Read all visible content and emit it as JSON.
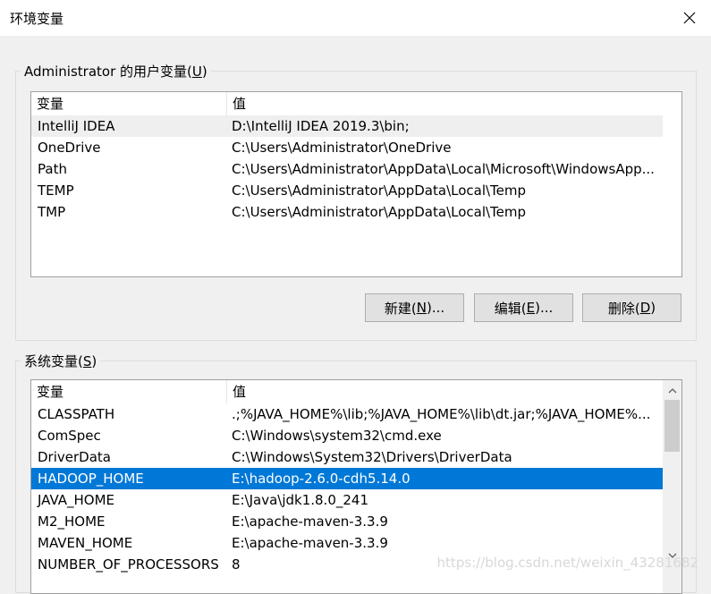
{
  "window": {
    "title": "环境变量"
  },
  "user_group": {
    "label_prefix": "Administrator 的用户变量(",
    "label_key": "U",
    "label_suffix": ")",
    "headers": {
      "name": "变量",
      "value": "值"
    },
    "rows": [
      {
        "name": "IntelliJ IDEA",
        "value": "D:\\IntelliJ IDEA 2019.3\\bin;"
      },
      {
        "name": "OneDrive",
        "value": "C:\\Users\\Administrator\\OneDrive"
      },
      {
        "name": "Path",
        "value": "C:\\Users\\Administrator\\AppData\\Local\\Microsoft\\WindowsApp..."
      },
      {
        "name": "TEMP",
        "value": "C:\\Users\\Administrator\\AppData\\Local\\Temp"
      },
      {
        "name": "TMP",
        "value": "C:\\Users\\Administrator\\AppData\\Local\\Temp"
      }
    ],
    "buttons": {
      "new": {
        "prefix": "新建(",
        "key": "N",
        "suffix": ")..."
      },
      "edit": {
        "prefix": "编辑(",
        "key": "E",
        "suffix": ")..."
      },
      "delete": {
        "prefix": "删除(",
        "key": "D",
        "suffix": ")"
      }
    }
  },
  "system_group": {
    "label_prefix": "系统变量(",
    "label_key": "S",
    "label_suffix": ")",
    "headers": {
      "name": "变量",
      "value": "值"
    },
    "rows": [
      {
        "name": "CLASSPATH",
        "value": ".;%JAVA_HOME%\\lib;%JAVA_HOME%\\lib\\dt.jar;%JAVA_HOME%..."
      },
      {
        "name": "ComSpec",
        "value": "C:\\Windows\\system32\\cmd.exe"
      },
      {
        "name": "DriverData",
        "value": "C:\\Windows\\System32\\Drivers\\DriverData"
      },
      {
        "name": "HADOOP_HOME",
        "value": "E:\\hadoop-2.6.0-cdh5.14.0"
      },
      {
        "name": "JAVA_HOME",
        "value": "E:\\Java\\jdk1.8.0_241"
      },
      {
        "name": "M2_HOME",
        "value": "E:\\apache-maven-3.3.9"
      },
      {
        "name": "MAVEN_HOME",
        "value": "E:\\apache-maven-3.3.9"
      },
      {
        "name": "NUMBER_OF_PROCESSORS",
        "value": "8"
      }
    ],
    "selected_index": 3
  },
  "watermark": "https://blog.csdn.net/weixin_43281682",
  "colors": {
    "selection": "#0078d7",
    "button": "#e1e1e1"
  }
}
